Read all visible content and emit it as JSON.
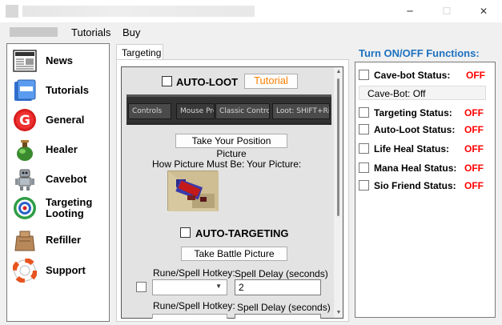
{
  "menu": {
    "items": [
      "Tutorials",
      "Buy"
    ]
  },
  "window": {
    "minimize": "─",
    "maximize": "☐",
    "close": "✕"
  },
  "sidebar": {
    "items": [
      {
        "label": "News",
        "icon": "news-icon"
      },
      {
        "label": "Tutorials",
        "icon": "tutorials-icon"
      },
      {
        "label": "General",
        "icon": "general-icon"
      },
      {
        "label": "Healer",
        "icon": "healer-icon"
      },
      {
        "label": "Cavebot",
        "icon": "cavebot-icon"
      },
      {
        "label": "Targeting\nLooting",
        "icon": "targeting-icon"
      },
      {
        "label": "Refiller",
        "icon": "refiller-icon"
      },
      {
        "label": "Support",
        "icon": "support-icon"
      }
    ]
  },
  "tab": {
    "label": "Targeting"
  },
  "targeting": {
    "autoloot_label": "AUTO-LOOT",
    "tutorial_button": "Tutorial",
    "game_bar": {
      "controls": "Controls",
      "mouse_preset": "Mouse Preset:",
      "classic_controls": "Classic Controls",
      "loot": "Loot: SHIFT+Right"
    },
    "take_position_button": "Take Your Position Picture",
    "how_picture_label": "How Picture Must Be:",
    "your_picture_label": "Your Picture:",
    "autotargeting_label": "AUTO-TARGETING",
    "take_battle_button": "Take Battle Picture",
    "rune_hotkey_label": "Rune/Spell Hotkey:",
    "spell_delay_label": "Spell Delay (seconds)",
    "spell_delay_value": "2",
    "rune_hotkey_label_2": "Rune/Spell Hotkey:",
    "spell_delay_label_2": "Spell Delay (seconds)"
  },
  "functions": {
    "title": "Turn ON/OFF Functions:",
    "cavebot_status_label": "Cave-bot Status:",
    "cavebot_status_value": "OFF",
    "cavebot_box": "Cave-Bot: Off",
    "rows": [
      {
        "label": "Targeting Status:",
        "value": "OFF"
      },
      {
        "label": "Auto-Loot Status:",
        "value": "OFF"
      },
      {
        "label": "Life Heal Status:",
        "value": "OFF"
      },
      {
        "label": "Mana Heal Status:",
        "value": "OFF"
      },
      {
        "label": "Sio Friend Status:",
        "value": "OFF"
      }
    ],
    "status_color": "#ff0000",
    "title_color": "#1c72c0"
  }
}
